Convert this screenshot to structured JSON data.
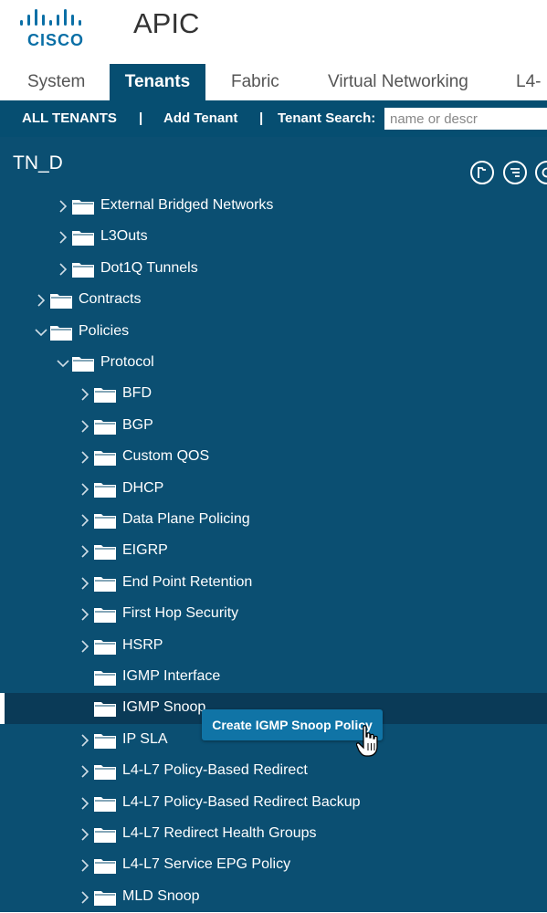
{
  "app": {
    "brand": "CISCO",
    "title": "APIC"
  },
  "tabs": [
    {
      "label": "System",
      "active": false
    },
    {
      "label": "Tenants",
      "active": true
    },
    {
      "label": "Fabric",
      "active": false
    },
    {
      "label": "Virtual Networking",
      "active": false
    },
    {
      "label": "L4-",
      "active": false
    }
  ],
  "subnav": {
    "all_tenants": "ALL TENANTS",
    "separator": "|",
    "add_tenant": "Add Tenant",
    "tenant_search_label": "Tenant Search:",
    "search_placeholder": "name or descr"
  },
  "tenant": {
    "name": "TN_D"
  },
  "tree": [
    {
      "label": "External Bridged Networks",
      "depth": 2,
      "expand": "collapsed"
    },
    {
      "label": "L3Outs",
      "depth": 2,
      "expand": "collapsed"
    },
    {
      "label": "Dot1Q Tunnels",
      "depth": 2,
      "expand": "collapsed"
    },
    {
      "label": "Contracts",
      "depth": 1,
      "expand": "collapsed"
    },
    {
      "label": "Policies",
      "depth": 1,
      "expand": "expanded"
    },
    {
      "label": "Protocol",
      "depth": 2,
      "expand": "expanded"
    },
    {
      "label": "BFD",
      "depth": 3,
      "expand": "collapsed"
    },
    {
      "label": "BGP",
      "depth": 3,
      "expand": "collapsed"
    },
    {
      "label": "Custom QOS",
      "depth": 3,
      "expand": "collapsed"
    },
    {
      "label": "DHCP",
      "depth": 3,
      "expand": "collapsed"
    },
    {
      "label": "Data Plane Policing",
      "depth": 3,
      "expand": "collapsed"
    },
    {
      "label": "EIGRP",
      "depth": 3,
      "expand": "collapsed"
    },
    {
      "label": "End Point Retention",
      "depth": 3,
      "expand": "collapsed"
    },
    {
      "label": "First Hop Security",
      "depth": 3,
      "expand": "collapsed"
    },
    {
      "label": "HSRP",
      "depth": 3,
      "expand": "collapsed"
    },
    {
      "label": "IGMP Interface",
      "depth": 3,
      "expand": "none"
    },
    {
      "label": "IGMP Snoop",
      "depth": 3,
      "expand": "none",
      "selected": true
    },
    {
      "label": "IP SLA",
      "depth": 3,
      "expand": "collapsed"
    },
    {
      "label": "L4-L7 Policy-Based Redirect",
      "depth": 3,
      "expand": "collapsed"
    },
    {
      "label": "L4-L7 Policy-Based Redirect Backup",
      "depth": 3,
      "expand": "collapsed"
    },
    {
      "label": "L4-L7 Redirect Health Groups",
      "depth": 3,
      "expand": "collapsed"
    },
    {
      "label": "L4-L7 Service EPG Policy",
      "depth": 3,
      "expand": "collapsed"
    },
    {
      "label": "MLD Snoop",
      "depth": 3,
      "expand": "collapsed"
    }
  ],
  "context_menu": {
    "label": "Create IGMP Snoop Policy"
  },
  "colors": {
    "panel_bg": "#0b4f72",
    "active_tab_bg": "#064e71",
    "selected_row_bg": "#0a3a57",
    "button_bg": "#1074a6",
    "brand_blue": "#0a6fa6"
  }
}
